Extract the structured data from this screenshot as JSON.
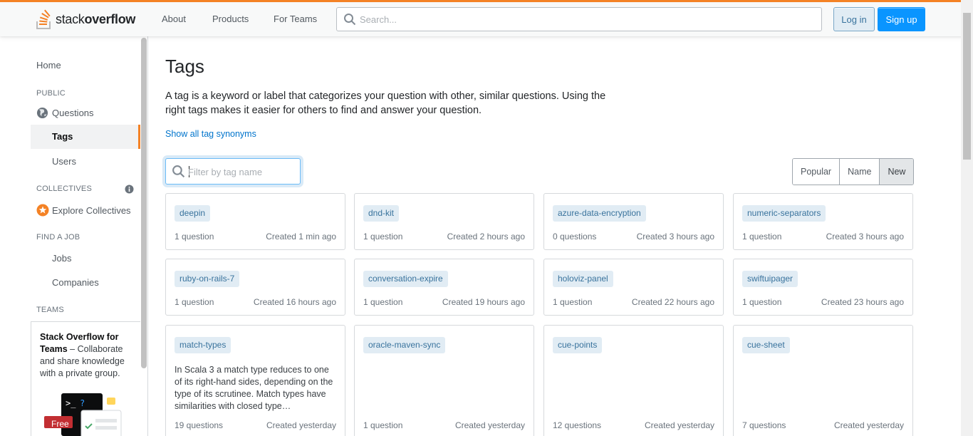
{
  "brand": {
    "logo_regular": "stack",
    "logo_bold": "overflow",
    "accent": "#f48225",
    "link_blue": "#0074cc",
    "button_blue": "#0a95ff"
  },
  "header": {
    "nav": [
      "About",
      "Products",
      "For Teams"
    ],
    "search_placeholder": "Search...",
    "login_label": "Log in",
    "signup_label": "Sign up"
  },
  "sidebar": {
    "home": "Home",
    "public_heading": "PUBLIC",
    "questions": "Questions",
    "tags": "Tags",
    "users": "Users",
    "collectives_heading": "COLLECTIVES",
    "explore_collectives": "Explore Collectives",
    "findjob_heading": "FIND A JOB",
    "jobs": "Jobs",
    "companies": "Companies",
    "teams_heading": "TEAMS",
    "teams_promo_bold": "Stack Overflow for Teams",
    "teams_promo_text": " – Collaborate and share knowledge with a private group.",
    "teams_free_badge": "Free"
  },
  "main": {
    "title": "Tags",
    "intro": "A tag is a keyword or label that categorizes your question with other, similar questions. Using the right tags makes it easier for others to find and answer your question.",
    "synonyms_link": "Show all tag synonyms",
    "filter_placeholder": "Filter by tag name",
    "sort_options": [
      "Popular",
      "Name",
      "New"
    ],
    "sort_active": "New"
  },
  "tags": [
    {
      "name": "deepin",
      "count": "1 question",
      "created": "Created 1 min ago",
      "excerpt": ""
    },
    {
      "name": "dnd-kit",
      "count": "1 question",
      "created": "Created 2 hours ago",
      "excerpt": ""
    },
    {
      "name": "azure-data-encryption",
      "count": "0 questions",
      "created": "Created 3 hours ago",
      "excerpt": ""
    },
    {
      "name": "numeric-separators",
      "count": "1 question",
      "created": "Created 3 hours ago",
      "excerpt": ""
    },
    {
      "name": "ruby-on-rails-7",
      "count": "1 question",
      "created": "Created 16 hours ago",
      "excerpt": ""
    },
    {
      "name": "conversation-expire",
      "count": "1 question",
      "created": "Created 19 hours ago",
      "excerpt": ""
    },
    {
      "name": "holoviz-panel",
      "count": "1 question",
      "created": "Created 22 hours ago",
      "excerpt": ""
    },
    {
      "name": "swiftuipager",
      "count": "1 question",
      "created": "Created 23 hours ago",
      "excerpt": ""
    },
    {
      "name": "match-types",
      "count": "19 questions",
      "created": "Created yesterday",
      "excerpt": "In Scala 3 a match type reduces to one of its right-hand sides, depending on the type of its scrutinee. Match types have similarities with closed type…"
    },
    {
      "name": "oracle-maven-sync",
      "count": "1 question",
      "created": "Created yesterday",
      "excerpt": ""
    },
    {
      "name": "cue-points",
      "count": "12 questions",
      "created": "Created yesterday",
      "excerpt": ""
    },
    {
      "name": "cue-sheet",
      "count": "7 questions",
      "created": "Created yesterday",
      "excerpt": ""
    }
  ]
}
